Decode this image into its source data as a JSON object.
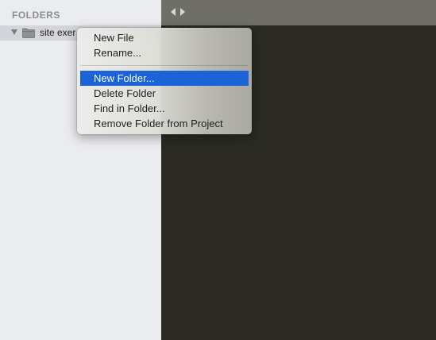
{
  "sidebar": {
    "heading": "FOLDERS",
    "folder": {
      "label": "site exer",
      "icon": "folder-icon",
      "expanded": true
    }
  },
  "tabbar": {
    "back_icon": "chevron-left-icon",
    "forward_icon": "chevron-right-icon"
  },
  "context_menu": {
    "items": [
      {
        "label": "New File"
      },
      {
        "label": "Rename..."
      },
      {
        "label": "New Folder...",
        "highlighted": true
      },
      {
        "label": "Delete Folder"
      },
      {
        "label": "Find in Folder..."
      },
      {
        "label": "Remove Folder from Project"
      }
    ]
  },
  "colors": {
    "sidebar_bg": "#ebecee",
    "selected_row_bg": "#d3d5da",
    "editor_bg": "#2b2b24",
    "tabbar_bg": "#6f6f68",
    "menu_highlight": "#1d63d8"
  }
}
